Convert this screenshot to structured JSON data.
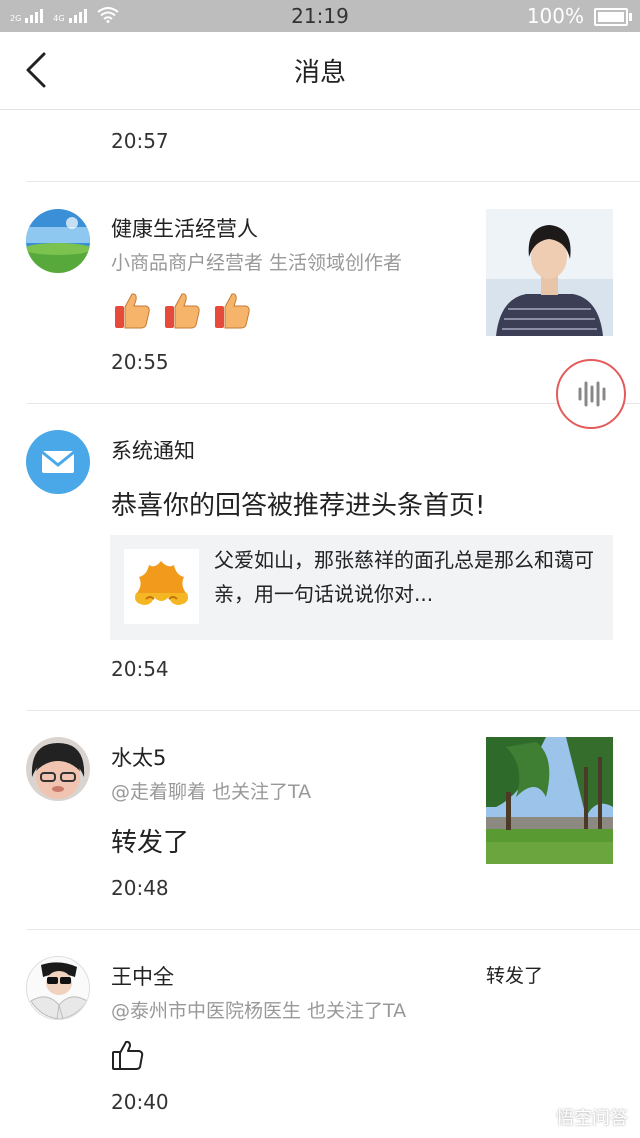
{
  "status_bar": {
    "time": "21:19",
    "battery": "100%",
    "net1": "2G",
    "net2": "4G",
    "net3": "2G"
  },
  "header": {
    "title": "消息"
  },
  "messages": [
    {
      "time": "20:57"
    },
    {
      "name": "健康生活经营人",
      "subtitle": "小商品商户经营者 生活领域创作者",
      "time": "20:55",
      "reaction": "thumbs-up x3"
    },
    {
      "name": "系统通知",
      "text": "恭喜你的回答被推荐进头条首页!",
      "card_text": "父爱如山，那张慈祥的面孔总是那么和蔼可亲，用一句话说说你对...",
      "time": "20:54"
    },
    {
      "name": "水太5",
      "subtitle": "@走着聊着 也关注了TA",
      "text": "转发了",
      "time": "20:48"
    },
    {
      "name": "王中全",
      "subtitle": "@泰州市中医院杨医生 也关注了TA",
      "right_text": "转发了",
      "time": "20:40"
    }
  ],
  "watermark": "悟空问答",
  "colors": {
    "accent_red": "#e45b5b",
    "notify_blue": "#4aa8e8",
    "sub_gray": "#999999"
  }
}
